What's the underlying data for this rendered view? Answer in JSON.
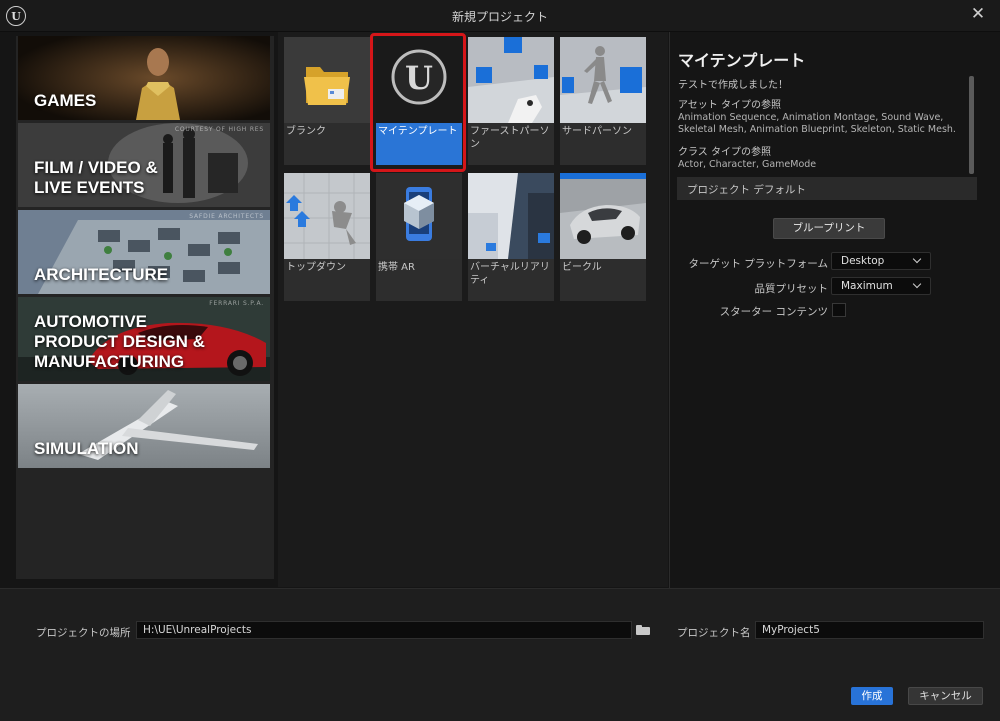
{
  "window": {
    "title": "新規プロジェクト",
    "close_glyph": "✕",
    "logo_glyph": "U"
  },
  "categories": [
    {
      "label": "GAMES",
      "credit": "",
      "selected": true
    },
    {
      "label": "FILM / VIDEO &\nLIVE EVENTS",
      "credit": "COURTESY OF HIGH RES",
      "selected": false
    },
    {
      "label": "ARCHITECTURE",
      "credit": "SAFDIE ARCHITECTS",
      "selected": false
    },
    {
      "label": "AUTOMOTIVE\nPRODUCT DESIGN &\nMANUFACTURING",
      "credit": "FERRARI S.P.A.",
      "selected": false
    },
    {
      "label": "SIMULATION",
      "credit": "",
      "selected": false
    }
  ],
  "templates": [
    {
      "label": "ブランク",
      "icon": "folder-icon",
      "selected": false
    },
    {
      "label": "マイテンプレート",
      "icon": "unreal-logo-icon",
      "selected": true
    },
    {
      "label": "ファーストパーソン",
      "icon": "first-person-icon",
      "selected": false
    },
    {
      "label": "サードパーソン",
      "icon": "third-person-icon",
      "selected": false
    },
    {
      "label": "トップダウン",
      "icon": "top-down-icon",
      "selected": false
    },
    {
      "label": "携帯 AR",
      "icon": "mobile-ar-icon",
      "selected": false
    },
    {
      "label": "バーチャルリアリティ",
      "icon": "virtual-reality-icon",
      "selected": false
    },
    {
      "label": "ビークル",
      "icon": "vehicle-icon",
      "selected": false
    }
  ],
  "details": {
    "title": "マイテンプレート",
    "description": "テストで作成しました！",
    "asset_types_heading": "アセット タイプの参照",
    "asset_types_value": "Animation Sequence, Animation Montage, Sound Wave, Skeletal Mesh, Animation Blueprint, Skeleton, Static Mesh.",
    "class_types_heading": "クラス タイプの参照",
    "class_types_value": "Actor, Character, GameMode",
    "defaults_heading": "プロジェクト デフォルト",
    "blueprint_button": "ブループリント",
    "target_platform_label": "ターゲット プラットフォーム",
    "target_platform_value": "Desktop",
    "quality_preset_label": "品質プリセット",
    "quality_preset_value": "Maximum",
    "starter_content_label": "スターター コンテンツ",
    "starter_content_checked": false
  },
  "bottom": {
    "location_label": "プロジェクトの場所",
    "location_value": "H:\\UE\\UnrealProjects",
    "name_label": "プロジェクト名",
    "name_value": "MyProject5",
    "create_button": "作成",
    "cancel_button": "キャンセル"
  },
  "colors": {
    "accent": "#2a75d6",
    "highlight_frame": "#d51619",
    "background": "#151515"
  }
}
